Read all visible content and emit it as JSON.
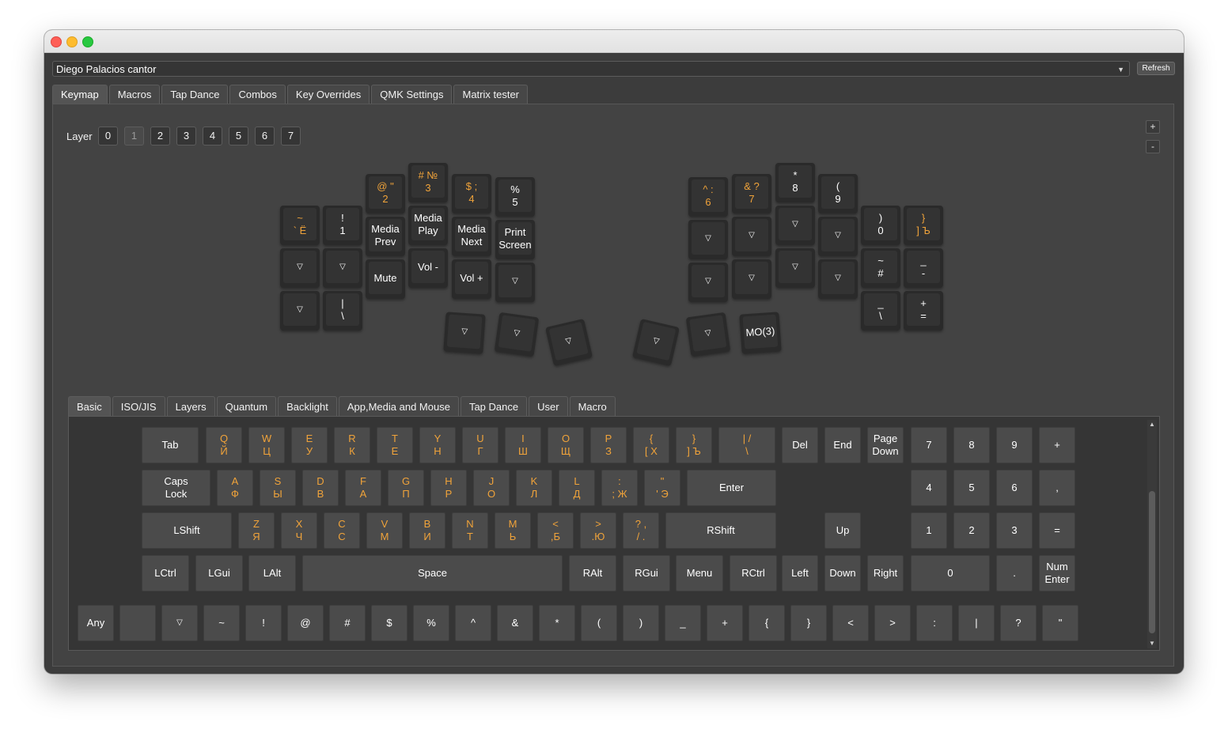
{
  "window": {
    "keyboard_name": "Diego Palacios cantor",
    "refresh_label": "Refresh"
  },
  "main_tabs": [
    "Keymap",
    "Macros",
    "Tap Dance",
    "Combos",
    "Key Overrides",
    "QMK Settings",
    "Matrix tester"
  ],
  "layer": {
    "label": "Layer",
    "buttons": [
      "0",
      "1",
      "2",
      "3",
      "4",
      "5",
      "6",
      "7"
    ],
    "selected": "1"
  },
  "zoom": {
    "plus": "+",
    "minus": "-"
  },
  "split_keys": [
    {
      "id": "l-c0-r0",
      "text": "~\n` Ё",
      "orange": true
    },
    {
      "id": "l-c0-r1",
      "text": "▽"
    },
    {
      "id": "l-c0-r2",
      "text": "▽"
    },
    {
      "id": "l-c1-r0",
      "text": "!\n1"
    },
    {
      "id": "l-c1-r1",
      "text": "▽"
    },
    {
      "id": "l-c1-r2",
      "text": "|\n\\"
    },
    {
      "id": "l-c2-r0",
      "text": "@ \"\n2",
      "orange": true
    },
    {
      "id": "l-c2-r1",
      "text": "Media\nPrev"
    },
    {
      "id": "l-c2-r2",
      "text": "Mute"
    },
    {
      "id": "l-c3-r0",
      "text": "# №\n3",
      "orange": true
    },
    {
      "id": "l-c3-r1",
      "text": "Media\nPlay"
    },
    {
      "id": "l-c3-r2",
      "text": "Vol -"
    },
    {
      "id": "l-c4-r0",
      "text": "$ ;\n4",
      "orange": true
    },
    {
      "id": "l-c4-r1",
      "text": "Media\nNext"
    },
    {
      "id": "l-c4-r2",
      "text": "Vol +"
    },
    {
      "id": "l-c5-r0",
      "text": "%\n5"
    },
    {
      "id": "l-c5-r1",
      "text": "Print\nScreen"
    },
    {
      "id": "l-c5-r2",
      "text": "▽"
    },
    {
      "id": "l-th-0",
      "text": "▽"
    },
    {
      "id": "l-th-1",
      "text": "▽"
    },
    {
      "id": "l-th-2",
      "text": "▽"
    },
    {
      "id": "r-c0-r0",
      "text": "^ :\n6",
      "orange": true
    },
    {
      "id": "r-c0-r1",
      "text": "▽"
    },
    {
      "id": "r-c0-r2",
      "text": "▽"
    },
    {
      "id": "r-c1-r0",
      "text": "& ?\n7",
      "orange": true
    },
    {
      "id": "r-c1-r1",
      "text": "▽"
    },
    {
      "id": "r-c1-r2",
      "text": "▽"
    },
    {
      "id": "r-c2-r0",
      "text": "*\n8"
    },
    {
      "id": "r-c2-r1",
      "text": "▽"
    },
    {
      "id": "r-c2-r2",
      "text": "▽"
    },
    {
      "id": "r-c3-r0",
      "text": "(\n9"
    },
    {
      "id": "r-c3-r1",
      "text": "▽"
    },
    {
      "id": "r-c3-r2",
      "text": "▽"
    },
    {
      "id": "r-c4-r0",
      "text": ")\n0"
    },
    {
      "id": "r-c4-r1",
      "text": "~\n#"
    },
    {
      "id": "r-c4-r2",
      "text": "_\n\\"
    },
    {
      "id": "r-c5-r0",
      "text": "}\n] Ъ",
      "orange": true
    },
    {
      "id": "r-c5-r1",
      "text": "_\n-"
    },
    {
      "id": "r-c5-r2",
      "text": "+\n="
    },
    {
      "id": "r-th-0",
      "text": "▽"
    },
    {
      "id": "r-th-1",
      "text": "▽"
    },
    {
      "id": "r-th-2",
      "text": "MO(3)"
    }
  ],
  "sub_tabs": [
    "Basic",
    "ISO/JIS",
    "Layers",
    "Quantum",
    "Backlight",
    "App,Media and Mouse",
    "Tap Dance",
    "User",
    "Macro"
  ],
  "basic_rows": [
    [
      {
        "t": "Tab"
      },
      {
        "t": "Q\nЙ",
        "o": true
      },
      {
        "t": "W\nЦ",
        "o": true
      },
      {
        "t": "E\nУ",
        "o": true
      },
      {
        "t": "R\nК",
        "o": true
      },
      {
        "t": "T\nЕ",
        "o": true
      },
      {
        "t": "Y\nН",
        "o": true
      },
      {
        "t": "U\nГ",
        "o": true
      },
      {
        "t": "I\nШ",
        "o": true
      },
      {
        "t": "O\nЩ",
        "o": true
      },
      {
        "t": "P\nЗ",
        "o": true
      },
      {
        "t": "{\n[ Х",
        "o": true
      },
      {
        "t": "}\n] Ъ",
        "o": true
      },
      {
        "t": "| /\n\\",
        "o": true
      },
      {
        "t": "Del"
      },
      {
        "t": "End"
      },
      {
        "t": "Page\nDown"
      },
      {
        "t": "7"
      },
      {
        "t": "8"
      },
      {
        "t": "9"
      },
      {
        "t": "+"
      }
    ],
    [
      {
        "t": "Caps\nLock"
      },
      {
        "t": "A\nФ",
        "o": true
      },
      {
        "t": "S\nЫ",
        "o": true
      },
      {
        "t": "D\nВ",
        "o": true
      },
      {
        "t": "F\nА",
        "o": true
      },
      {
        "t": "G\nП",
        "o": true
      },
      {
        "t": "H\nР",
        "o": true
      },
      {
        "t": "J\nО",
        "o": true
      },
      {
        "t": "K\nЛ",
        "o": true
      },
      {
        "t": "L\nД",
        "o": true
      },
      {
        "t": ":\n; Ж",
        "o": true
      },
      {
        "t": "\"\n' Э",
        "o": true
      },
      {
        "t": "Enter"
      },
      {
        "t": "4"
      },
      {
        "t": "5"
      },
      {
        "t": "6"
      },
      {
        "t": ","
      }
    ],
    [
      {
        "t": "LShift"
      },
      {
        "t": "Z\nЯ",
        "o": true
      },
      {
        "t": "X\nЧ",
        "o": true
      },
      {
        "t": "C\nС",
        "o": true
      },
      {
        "t": "V\nМ",
        "o": true
      },
      {
        "t": "B\nИ",
        "o": true
      },
      {
        "t": "N\nТ",
        "o": true
      },
      {
        "t": "M\nЬ",
        "o": true
      },
      {
        "t": "<\n,Б",
        "o": true
      },
      {
        "t": ">\n.Ю",
        "o": true
      },
      {
        "t": "? ,\n/ .",
        "o": true
      },
      {
        "t": "RShift"
      },
      {
        "t": "Up"
      },
      {
        "t": "1"
      },
      {
        "t": "2"
      },
      {
        "t": "3"
      },
      {
        "t": "="
      }
    ],
    [
      {
        "t": "LCtrl"
      },
      {
        "t": "LGui"
      },
      {
        "t": "LAlt"
      },
      {
        "t": "Space"
      },
      {
        "t": "RAlt"
      },
      {
        "t": "RGui"
      },
      {
        "t": "Menu"
      },
      {
        "t": "RCtrl"
      },
      {
        "t": "Left"
      },
      {
        "t": "Down"
      },
      {
        "t": "Right"
      },
      {
        "t": "0"
      },
      {
        "t": "."
      },
      {
        "t": "Num\nEnter"
      }
    ],
    [
      {
        "t": "Any"
      },
      {
        "t": ""
      },
      {
        "t": "▽"
      },
      {
        "t": "~"
      },
      {
        "t": "!"
      },
      {
        "t": "@"
      },
      {
        "t": "#"
      },
      {
        "t": "$"
      },
      {
        "t": "%"
      },
      {
        "t": "^"
      },
      {
        "t": "&"
      },
      {
        "t": "*"
      },
      {
        "t": "("
      },
      {
        "t": ")"
      },
      {
        "t": "_"
      },
      {
        "t": "+"
      },
      {
        "t": "{"
      },
      {
        "t": "}"
      },
      {
        "t": "<"
      },
      {
        "t": ">"
      },
      {
        "t": ":"
      },
      {
        "t": "|"
      },
      {
        "t": "?"
      },
      {
        "t": "\""
      }
    ]
  ]
}
